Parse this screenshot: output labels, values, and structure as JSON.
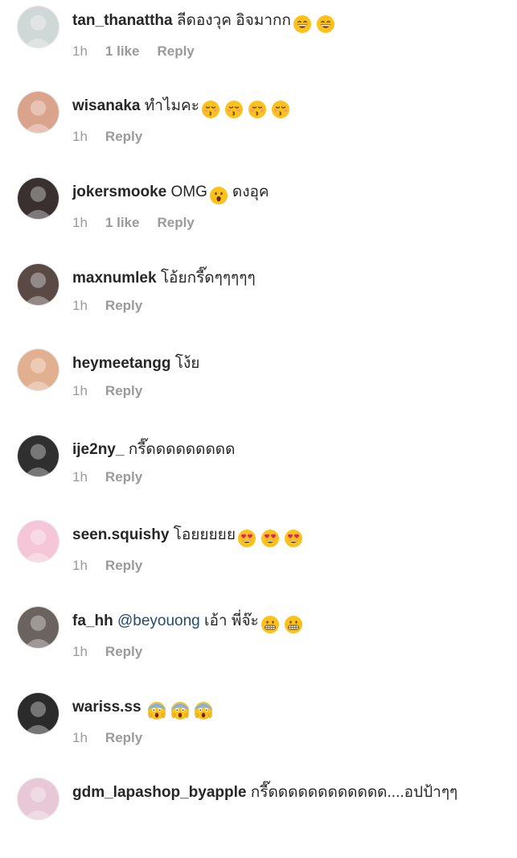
{
  "comments": [
    {
      "username": "tan_thanattha",
      "mention": "",
      "text": "ลีดองวุค  อิจมากก",
      "emoji": "grinning-face-icon",
      "emoji_count": 2,
      "time": "1h",
      "likes": "1 like",
      "reply": "Reply",
      "avatar_color": "#cfd8d6"
    },
    {
      "username": "wisanaka",
      "mention": "",
      "text": "ทำไมคะ",
      "emoji": "kissing-face-icon",
      "emoji_count": 4,
      "time": "1h",
      "likes": "",
      "reply": "Reply",
      "avatar_color": "#d9a38c"
    },
    {
      "username": "jokersmooke",
      "mention": "",
      "text": "OMG",
      "emoji": "surprised-face-icon",
      "emoji_count": 1,
      "text_after": "ดงอุค",
      "time": "1h",
      "likes": "1 like",
      "reply": "Reply",
      "avatar_color": "#3a3030"
    },
    {
      "username": "maxnumlek",
      "mention": "",
      "text": "โอ้ยกรี๊ดๆๆๆๆๆ",
      "emoji": "",
      "emoji_count": 0,
      "time": "1h",
      "likes": "",
      "reply": "Reply",
      "avatar_color": "#5a4a46"
    },
    {
      "username": "heymeetangg",
      "mention": "",
      "text": "โง้ย",
      "emoji": "",
      "emoji_count": 0,
      "time": "1h",
      "likes": "",
      "reply": "Reply",
      "avatar_color": "#e0b090"
    },
    {
      "username": "ije2ny_",
      "mention": "",
      "text": "กรี๊ดดดดดดดดด",
      "emoji": "",
      "emoji_count": 0,
      "time": "1h",
      "likes": "",
      "reply": "Reply",
      "avatar_color": "#2f2f2f"
    },
    {
      "username": "seen.squishy",
      "mention": "",
      "text": "โอยยยยย",
      "emoji": "heart-eyes-face-icon",
      "emoji_count": 3,
      "time": "1h",
      "likes": "",
      "reply": "Reply",
      "avatar_color": "#f4c6d8"
    },
    {
      "username": "fa_hh",
      "mention": "@beyouong",
      "text": " เอ้า พี่จ๊ะ",
      "emoji": "grimacing-face-icon",
      "emoji_count": 2,
      "time": "1h",
      "likes": "",
      "reply": "Reply",
      "avatar_color": "#6a6360"
    },
    {
      "username": "wariss.ss",
      "mention": "",
      "text": "",
      "emoji": "screaming-face-icon",
      "emoji_count": 3,
      "time": "1h",
      "likes": "",
      "reply": "Reply",
      "avatar_color": "#2b2b2b"
    },
    {
      "username": "gdm_lapashop_byapple",
      "mention": "",
      "text": "กรี๊ดดดดดดดดดดดด....อปป้าๆๆ",
      "emoji": "",
      "emoji_count": 0,
      "time": "",
      "likes": "",
      "reply": "",
      "avatar_color": "#e8c7d6"
    }
  ]
}
